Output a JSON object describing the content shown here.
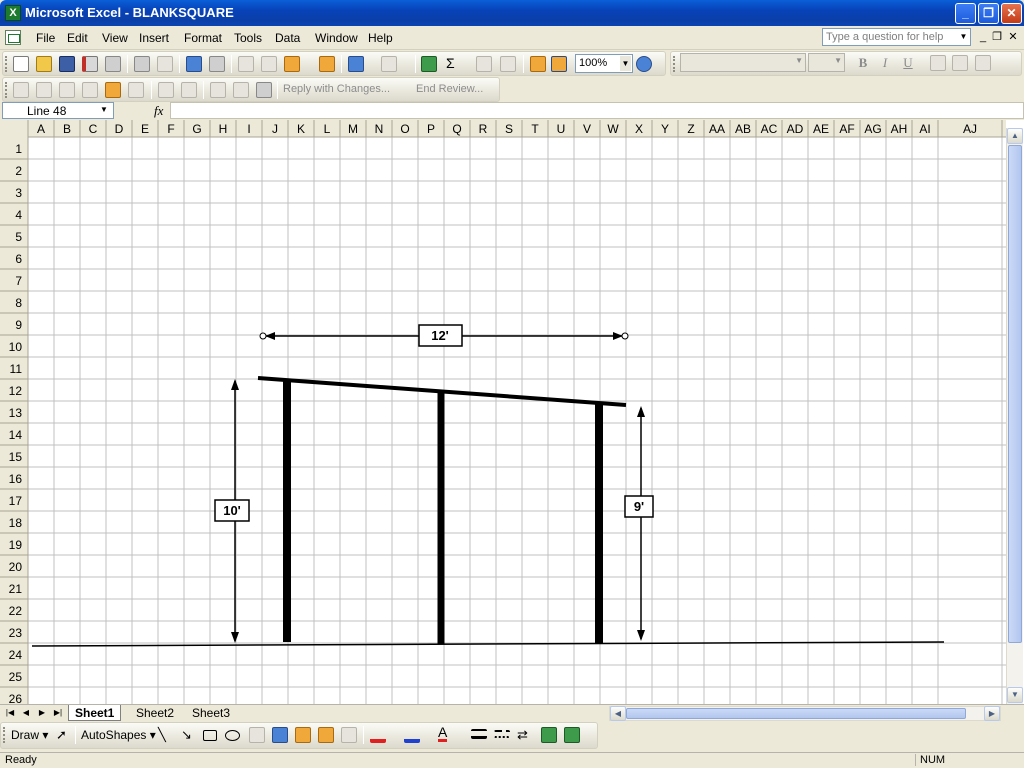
{
  "window": {
    "title": "Microsoft Excel - BLANKSQUARE",
    "app_icon": "excel-icon"
  },
  "menu": {
    "items": [
      "File",
      "Edit",
      "View",
      "Insert",
      "Format",
      "Tools",
      "Data",
      "Window",
      "Help"
    ],
    "help_placeholder": "Type a question for help"
  },
  "standard_toolbar": {
    "zoom": "100%"
  },
  "reviewing_toolbar": {
    "reply_label": "Reply with Changes...",
    "end_review_label": "End Review..."
  },
  "formatting_toolbar": {
    "bold": "B",
    "italic": "I",
    "underline": "U"
  },
  "formula_bar": {
    "name_box": "Line 48",
    "fx": "fx",
    "formula": ""
  },
  "columns": [
    "A",
    "B",
    "C",
    "D",
    "E",
    "F",
    "G",
    "H",
    "I",
    "J",
    "K",
    "L",
    "M",
    "N",
    "O",
    "P",
    "Q",
    "R",
    "S",
    "T",
    "U",
    "V",
    "W",
    "X",
    "Y",
    "Z",
    "AA",
    "AB",
    "AC",
    "AD",
    "AE",
    "AF",
    "AG",
    "AH",
    "AI",
    "AJ"
  ],
  "rows": [
    "1",
    "2",
    "3",
    "4",
    "5",
    "6",
    "7",
    "8",
    "9",
    "10",
    "11",
    "12",
    "13",
    "14",
    "15",
    "16",
    "17",
    "18",
    "19",
    "20",
    "21",
    "22",
    "23",
    "24",
    "25",
    "26"
  ],
  "drawing": {
    "width_label": "12'",
    "left_height_label": "10'",
    "right_height_label": "9'"
  },
  "sheets": [
    "Sheet1",
    "Sheet2",
    "Sheet3"
  ],
  "drawing_toolbar": {
    "draw": "Draw",
    "autoshapes": "AutoShapes"
  },
  "status": {
    "text": "Ready",
    "num": "NUM"
  }
}
